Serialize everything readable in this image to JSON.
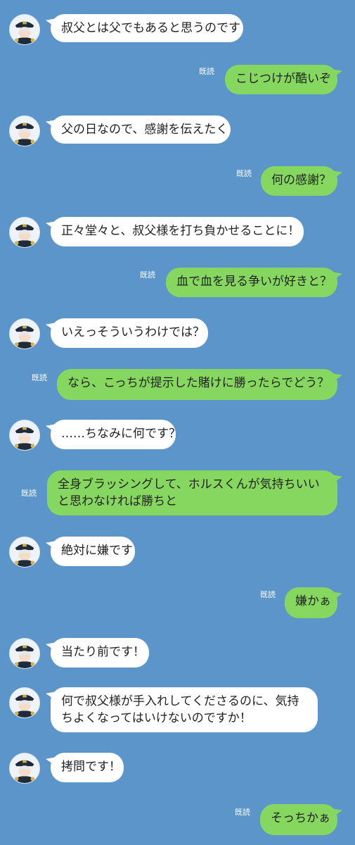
{
  "read_label": "既読",
  "messages": [
    {
      "from": "other",
      "text": "叔父とは父でもあると思うのです"
    },
    {
      "from": "me",
      "text": "こじつけが酷いぞ",
      "read": "既読"
    },
    {
      "from": "other",
      "text": "父の日なので、感謝を伝えたく"
    },
    {
      "from": "me",
      "text": "何の感謝？",
      "read": "既読"
    },
    {
      "from": "other",
      "text": "正々堂々と、叔父様を打ち負かせることに！"
    },
    {
      "from": "me",
      "text": "血で血を見る争いが好きと？",
      "read": "既読"
    },
    {
      "from": "other",
      "text": "いえっそういうわけでは？"
    },
    {
      "from": "me",
      "text": "なら、こっちが提示した賭けに勝ったらでどう？",
      "read": "既読"
    },
    {
      "from": "other",
      "text": "……ちなみに何です？"
    },
    {
      "from": "me",
      "text": "全身ブラッシングして、ホルスくんが気持ちいいと思わなければ勝ちと",
      "read": "既読"
    },
    {
      "from": "other",
      "text": "絶対に嫌です"
    },
    {
      "from": "me",
      "text": "嫌かぁ",
      "read": "既読"
    },
    {
      "from": "other",
      "text": "当たり前です！"
    },
    {
      "from": "other",
      "text": "何で叔父様が手入れしてくださるのに、気持ちよくなってはいけないのですか！"
    },
    {
      "from": "other",
      "text": "拷問です！"
    },
    {
      "from": "me",
      "text": "そっちかぁ",
      "read": "既読"
    }
  ]
}
